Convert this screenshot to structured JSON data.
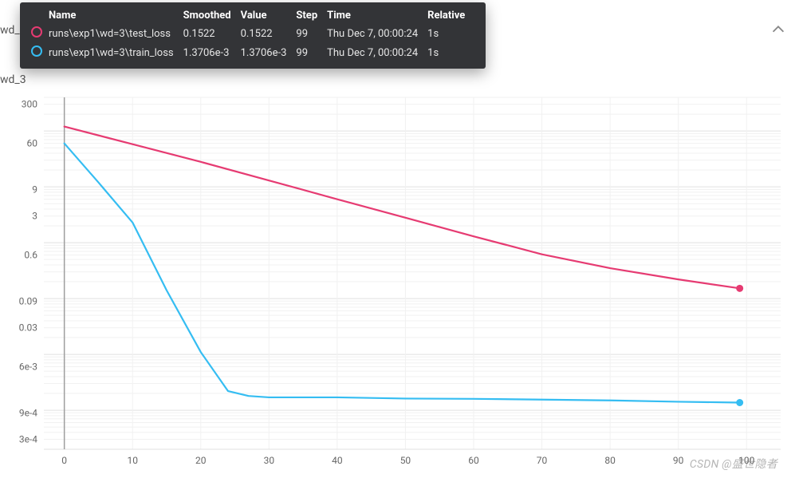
{
  "faint_tags": {
    "top": "wd_?",
    "second": "wd_3"
  },
  "tooltip": {
    "headers": [
      "Name",
      "Smoothed",
      "Value",
      "Step",
      "Time",
      "Relative"
    ],
    "rows": [
      {
        "swatch_fill": "#333437",
        "swatch_border": "#e63b72",
        "name": "runs\\exp1\\wd=3\\test_loss",
        "smoothed": "0.1522",
        "value": "0.1522",
        "step": "99",
        "time": "Thu Dec 7, 00:00:24",
        "relative": "1s"
      },
      {
        "swatch_fill": "#333437",
        "swatch_border": "#35bdf2",
        "name": "runs\\exp1\\wd=3\\train_loss",
        "smoothed": "1.3706e-3",
        "value": "1.3706e-3",
        "step": "99",
        "time": "Thu Dec 7, 00:00:24",
        "relative": "1s"
      }
    ]
  },
  "watermark": "CSDN @盛世隐者",
  "chart_data": {
    "type": "line",
    "title": "wd_3",
    "xlabel": "",
    "ylabel": "",
    "x_ticks": [
      0,
      10,
      20,
      30,
      40,
      50,
      60,
      70,
      80,
      90,
      100
    ],
    "y_ticks": [
      300,
      60,
      9,
      3,
      0.6,
      0.09,
      0.03,
      0.006,
      0.0009,
      0.0003
    ],
    "y_scale": "log",
    "xlim": [
      -3,
      105
    ],
    "ylim": [
      0.0002,
      400
    ],
    "cursor_x": 0,
    "series": [
      {
        "name": "runs\\exp1\\wd=3\\test_loss",
        "color": "#e63b72",
        "x": [
          0,
          10,
          20,
          30,
          40,
          50,
          60,
          70,
          80,
          90,
          99
        ],
        "values": [
          120,
          58,
          28,
          13,
          6.0,
          2.8,
          1.3,
          0.62,
          0.35,
          0.22,
          0.1522
        ],
        "end_marker": true
      },
      {
        "name": "runs\\exp1\\wd=3\\train_loss",
        "color": "#35bdf2",
        "x": [
          0,
          5,
          10,
          15,
          20,
          24,
          27,
          30,
          40,
          50,
          60,
          70,
          80,
          90,
          99
        ],
        "values": [
          60,
          12,
          2.3,
          0.14,
          0.011,
          0.0022,
          0.0018,
          0.0017,
          0.0017,
          0.00162,
          0.0016,
          0.00155,
          0.0015,
          0.00142,
          0.0013706
        ],
        "end_marker": true
      }
    ]
  }
}
